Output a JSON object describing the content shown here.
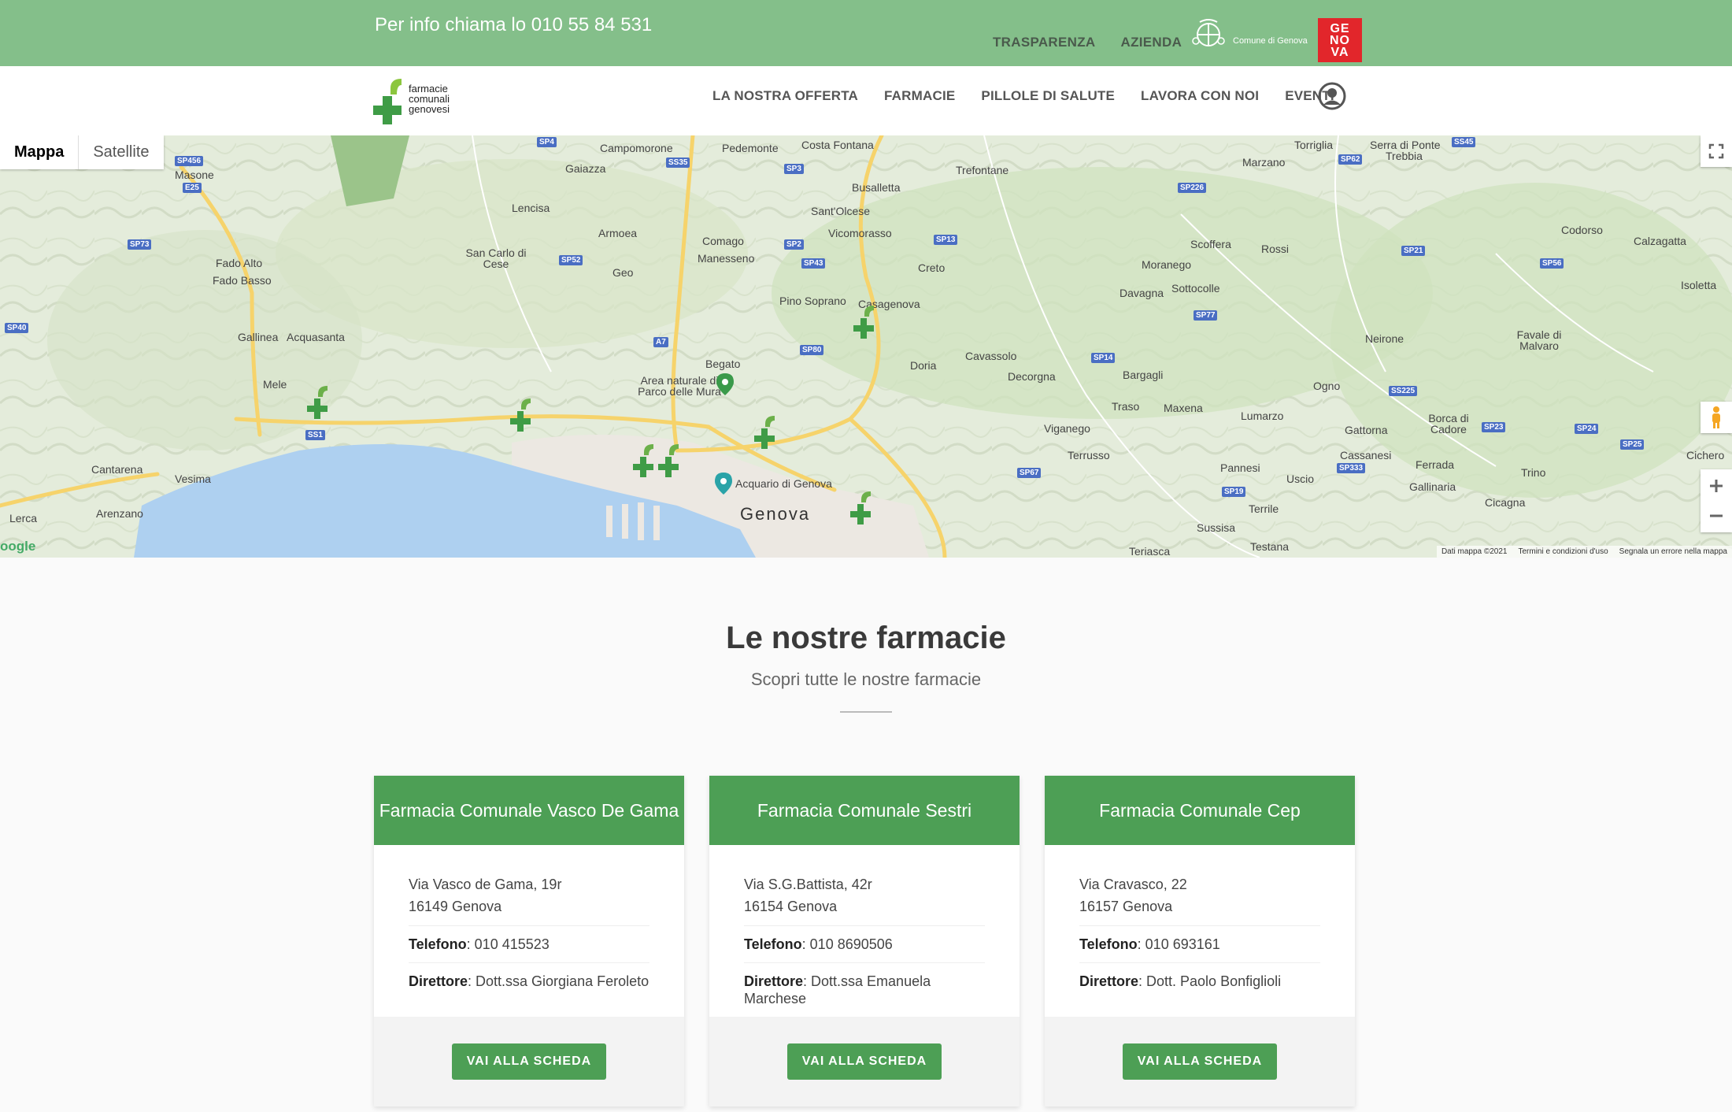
{
  "topbar": {
    "phone": "Per info chiama lo 010 55 84 531",
    "links": [
      "TRASPARENZA",
      "AZIENDA"
    ],
    "comune_label": "Comune di Genova",
    "genova_logo": [
      "GE",
      "NO",
      "VA"
    ]
  },
  "brand": {
    "lines": [
      "farmacie",
      "comunali",
      "genovesi"
    ]
  },
  "nav": {
    "items": [
      "LA NOSTRA OFFERTA",
      "FARMACIE",
      "PILLOLE DI SALUTE",
      "LAVORA CON NOI",
      "EVENTI"
    ]
  },
  "map": {
    "tabs": {
      "map": "Mappa",
      "satellite": "Satellite"
    },
    "city_label": "Genova",
    "places": [
      "Campomorone",
      "Pedemonte",
      "Costa Fontana",
      "Torriglia",
      "Serra di Ponte",
      "Trebbia",
      "Gaiazza",
      "Trefontane",
      "Marzano",
      "Masone",
      "Busalletta",
      "Sant'Olcese",
      "Vicomorasso",
      "Lencisa",
      "Armoea",
      "Comago",
      "Manesseno",
      "Creto",
      "Scoffera",
      "Rossi",
      "Codorso",
      "Calzagatta",
      "Fado Alto",
      "Fado Basso",
      "San Carlo di Cese",
      "Geo",
      "Pino Soprano",
      "Casagenova",
      "Moranego",
      "Davagna",
      "Sottocolle",
      "Isoletta",
      "Gallinea",
      "Acquasanta",
      "Begato",
      "Area naturale di Parco delle Mura",
      "Doria",
      "Cavassolo",
      "Bargagli",
      "Neirone",
      "Favale di Malvaro",
      "Mele",
      "Decorgna",
      "Traso",
      "Maxena",
      "Ogno",
      "Borca di Cadore",
      "Lumarzo",
      "Gattorna",
      "Cassanesi",
      "Viganego",
      "Terrusso",
      "Cantarena",
      "Vesima",
      "Pannesi",
      "Ferrada",
      "Cichero",
      "Uscio",
      "Trino",
      "Gallinaria",
      "Acquario di Genova",
      "Terrile",
      "Cicagna",
      "Lerca",
      "Arenzano",
      "Sussisa",
      "Testana",
      "Teriasca"
    ],
    "roads": [
      "SP456",
      "E25",
      "SP4",
      "SS35",
      "SP3",
      "SP2",
      "SP13",
      "SP226",
      "SP62",
      "SS45",
      "SP73",
      "SP52",
      "SP43",
      "SP77",
      "SP21",
      "SP56",
      "SP40",
      "A7",
      "SP80",
      "SS1",
      "SP14",
      "SS225",
      "SP67",
      "SP19",
      "SP333",
      "SP23",
      "SP24",
      "SP25"
    ],
    "footer": [
      "Dati mappa ©2021",
      "Termini e condizioni d'uso",
      "Segnala un errore nella mappa"
    ],
    "google": "oogle"
  },
  "section": {
    "title": "Le nostre farmacie",
    "subtitle": "Scopri tutte le nostre farmacie"
  },
  "cards": [
    {
      "name": "Farmacia Comunale Vasco De Gama",
      "address1": "Via Vasco de Gama, 19r",
      "address2": "16149 Genova",
      "phone_label": "Telefono",
      "phone": ": 010 415523",
      "director_label": "Direttore",
      "director": ": Dott.ssa Giorgiana Feroleto",
      "button": "VAI ALLA SCHEDA"
    },
    {
      "name": "Farmacia Comunale Sestri",
      "address1": "Via S.G.Battista, 42r",
      "address2": "16154 Genova",
      "phone_label": "Telefono",
      "phone": ": 010 8690506",
      "director_label": "Direttore",
      "director": ": Dott.ssa Emanuela Marchese",
      "button": "VAI ALLA SCHEDA"
    },
    {
      "name": "Farmacia Comunale Cep",
      "address1": "Via Cravasco, 22",
      "address2": "16157 Genova",
      "phone_label": "Telefono",
      "phone": ": 010 693161",
      "director_label": "Direttore",
      "director": ": Dott. Paolo Bonfiglioli",
      "button": "VAI ALLA SCHEDA"
    }
  ],
  "colors": {
    "topbar": "#84bf8a",
    "brand_green": "#4d9f55",
    "sea": "#aed0f0",
    "roads": "#f6d36b"
  }
}
